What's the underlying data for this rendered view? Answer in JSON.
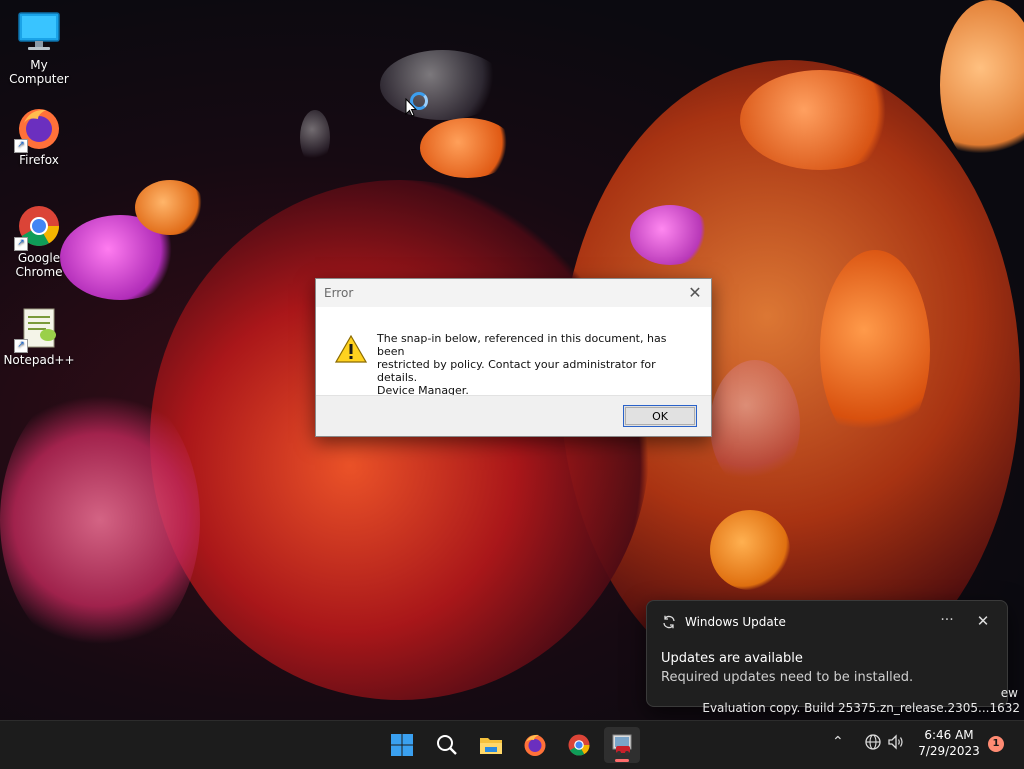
{
  "desktop": {
    "icons": [
      {
        "label": "My Computer",
        "icon": "monitor-icon"
      },
      {
        "label": "Firefox",
        "icon": "firefox-icon"
      },
      {
        "label": "Google Chrome",
        "icon": "chrome-icon"
      },
      {
        "label": "Notepad++",
        "icon": "notepad-plus-plus-icon"
      }
    ]
  },
  "dialog": {
    "title": "Error",
    "message_line1": "The snap-in below, referenced in this document, has been",
    "message_line2": "restricted by policy. Contact your administrator for details.",
    "message_line3": "Device Manager.",
    "ok_label": "OK",
    "icon": "warning-icon"
  },
  "toast": {
    "app_name": "Windows Update",
    "heading": "Updates are available",
    "body": "Required updates need to be installed."
  },
  "watermark": {
    "line1": "ew",
    "line2": "Evaluation copy. Build 25375.zn_release.2305...1632"
  },
  "taskbar": {
    "apps": [
      "start-icon",
      "search-icon",
      "file-explorer-icon",
      "firefox-icon",
      "chrome-icon",
      "device-manager-icon"
    ],
    "clock_time": "6:46 AM",
    "clock_date": "7/29/2023",
    "notification_count": "1"
  },
  "colors": {
    "accent": "#2a62c9",
    "toast_bg": "#1f1f1f",
    "taskbar_bg": "#1c1c1c",
    "badge": "#ff8b73"
  }
}
